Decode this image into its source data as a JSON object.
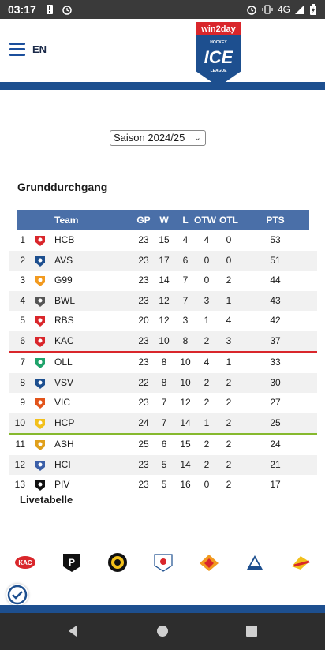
{
  "status": {
    "time": "03:17",
    "network": "4G"
  },
  "header": {
    "lang": "EN",
    "logo_text_top": "win2day",
    "logo_text_mid": "HOCKEY",
    "logo_text_ice": "ICE",
    "logo_text_bottom": "LEAGUE"
  },
  "season": {
    "selected": "Saison 2024/25"
  },
  "section": {
    "title": "Grunddurchgang",
    "live_label": "Livetabelle"
  },
  "table": {
    "headers": {
      "team": "Team",
      "gp": "GP",
      "w": "W",
      "l": "L",
      "otw": "OTW",
      "otl": "OTL",
      "pts": "PTS"
    },
    "rows": [
      {
        "pos": "1",
        "team": "HCB",
        "gp": "23",
        "w": "15",
        "l": "4",
        "otw": "4",
        "otl": "0",
        "pts": "53"
      },
      {
        "pos": "2",
        "team": "AVS",
        "gp": "23",
        "w": "17",
        "l": "6",
        "otw": "0",
        "otl": "0",
        "pts": "51"
      },
      {
        "pos": "3",
        "team": "G99",
        "gp": "23",
        "w": "14",
        "l": "7",
        "otw": "0",
        "otl": "2",
        "pts": "44"
      },
      {
        "pos": "4",
        "team": "BWL",
        "gp": "23",
        "w": "12",
        "l": "7",
        "otw": "3",
        "otl": "1",
        "pts": "43"
      },
      {
        "pos": "5",
        "team": "RBS",
        "gp": "20",
        "w": "12",
        "l": "3",
        "otw": "1",
        "otl": "4",
        "pts": "42"
      },
      {
        "pos": "6",
        "team": "KAC",
        "gp": "23",
        "w": "10",
        "l": "8",
        "otw": "2",
        "otl": "3",
        "pts": "37"
      },
      {
        "pos": "7",
        "team": "OLL",
        "gp": "23",
        "w": "8",
        "l": "10",
        "otw": "4",
        "otl": "1",
        "pts": "33"
      },
      {
        "pos": "8",
        "team": "VSV",
        "gp": "22",
        "w": "8",
        "l": "10",
        "otw": "2",
        "otl": "2",
        "pts": "30"
      },
      {
        "pos": "9",
        "team": "VIC",
        "gp": "23",
        "w": "7",
        "l": "12",
        "otw": "2",
        "otl": "2",
        "pts": "27"
      },
      {
        "pos": "10",
        "team": "HCP",
        "gp": "24",
        "w": "7",
        "l": "14",
        "otw": "1",
        "otl": "2",
        "pts": "25"
      },
      {
        "pos": "11",
        "team": "ASH",
        "gp": "25",
        "w": "6",
        "l": "15",
        "otw": "2",
        "otl": "2",
        "pts": "24"
      },
      {
        "pos": "12",
        "team": "HCI",
        "gp": "23",
        "w": "5",
        "l": "14",
        "otw": "2",
        "otl": "2",
        "pts": "21"
      },
      {
        "pos": "13",
        "team": "PIV",
        "gp": "23",
        "w": "5",
        "l": "16",
        "otw": "0",
        "otl": "2",
        "pts": "17"
      }
    ]
  },
  "colors": {
    "brand_blue": "#1d4f8f",
    "header_blue": "#4a6fa8",
    "playoff_line": "#d9262b",
    "preplayoff_line": "#86b92e"
  }
}
